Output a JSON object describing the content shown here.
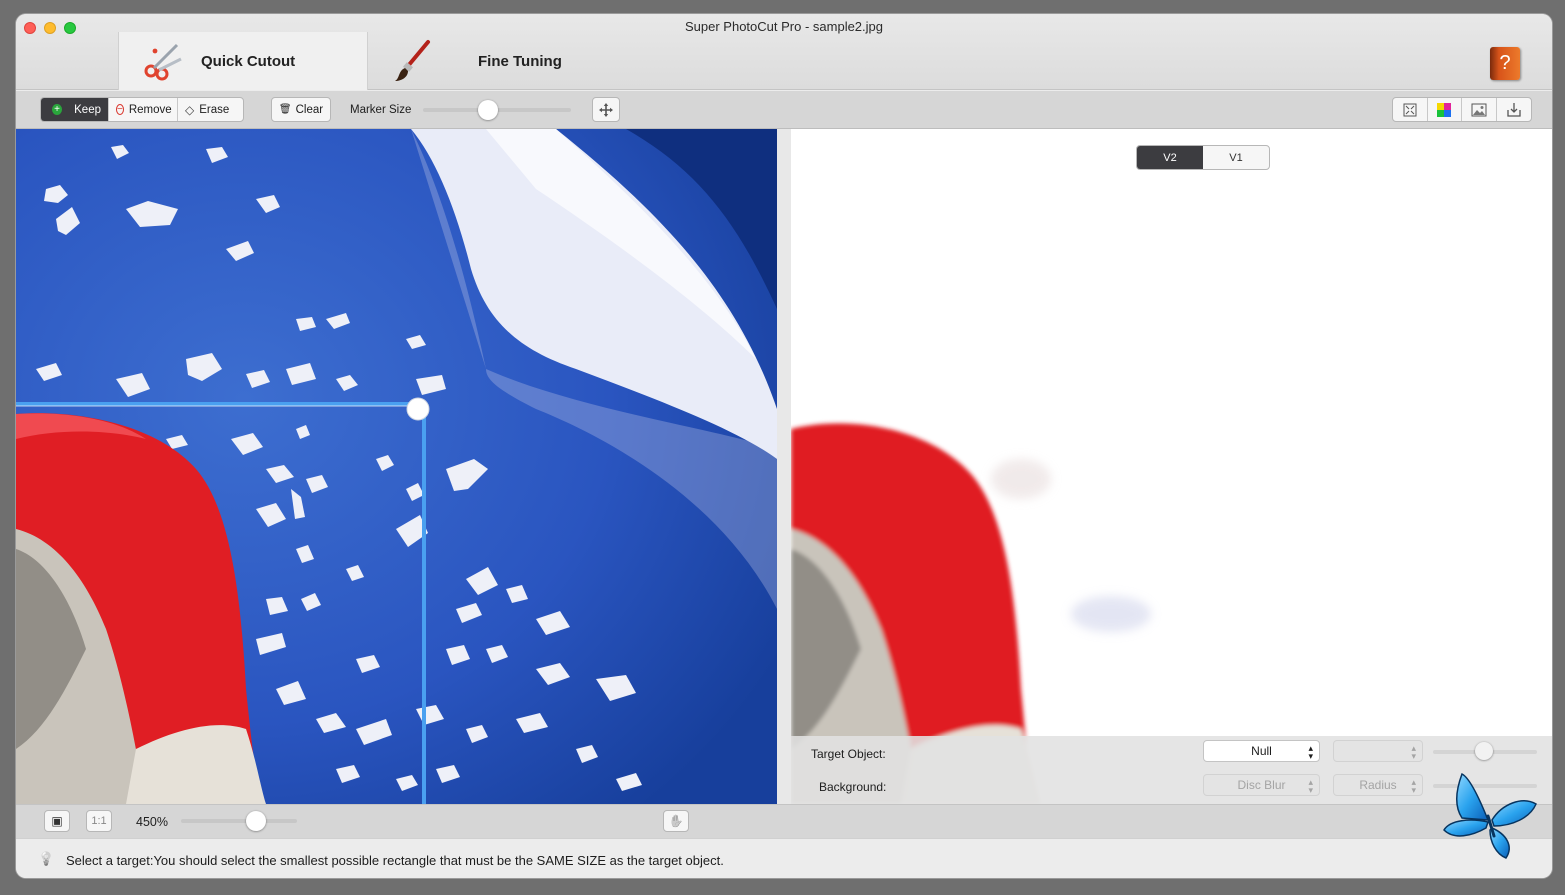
{
  "window": {
    "title": "Super PhotoCut Pro - sample2.jpg"
  },
  "tabs": {
    "quick_cutout": "Quick Cutout",
    "fine_tuning": "Fine Tuning"
  },
  "help": {
    "glyph": "?"
  },
  "toolbar": {
    "keep": "Keep",
    "keep_glyph": "+",
    "remove": "Remove",
    "remove_glyph": "−",
    "erase": "Erase",
    "erase_glyph": "◇",
    "clear": "Clear",
    "clear_glyph": "🗑",
    "marker_size_label": "Marker Size",
    "marker_size_fraction": 0.43
  },
  "preview": {
    "versions": [
      "V2",
      "V1"
    ],
    "selected_version": "V2",
    "target_object_label": "Target Object:",
    "target_object_value": "Null",
    "background_label": "Background:",
    "background_value": "Disc Blur",
    "radius_placeholder": "Radius"
  },
  "bottom": {
    "fit_glyph": "▣",
    "actual_size": "1:1",
    "zoom": "450%",
    "zoom_fraction": 0.68,
    "hand_glyph": "✋"
  },
  "status": {
    "tip_glyph": "💡",
    "message": "Select a target:You should select the smallest possible rectangle that must be the SAME SIZE as the target object."
  },
  "colors": {
    "accent": "#3c3c40",
    "selection_rect": "#4aa0f0",
    "keep_green": "#2aa63c",
    "remove_red": "#d9342b"
  }
}
